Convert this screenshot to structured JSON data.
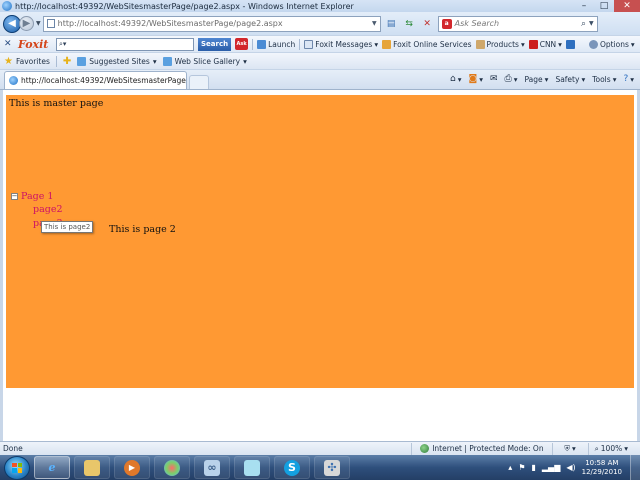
{
  "window": {
    "title": "http://localhost:49392/WebSitesmasterPage/page2.aspx - Windows Internet Explorer"
  },
  "address": {
    "url": "http://localhost:49392/WebSitesmasterPage/page2.aspx",
    "search_placeholder": "Ask Search"
  },
  "foxit": {
    "logo": "Foxit",
    "search_button": "Search",
    "ask_label": "Ask",
    "items": [
      "Launch",
      "Foxit Messages",
      "Foxit Online Services",
      "Products",
      "CNN",
      "Options"
    ]
  },
  "favorites": {
    "label": "Favorites",
    "items": [
      "Suggested Sites",
      "Web Slice Gallery"
    ]
  },
  "tab": {
    "label": "http://localhost:49392/WebSitesmasterPage/pag..."
  },
  "commands": {
    "page": "Page",
    "safety": "Safety",
    "tools": "Tools"
  },
  "content": {
    "master_text": "This is master page",
    "tree": {
      "root": "Page 1",
      "root_toggle": "−",
      "children": [
        "page2",
        "page3"
      ]
    },
    "page_text": "This is page 2",
    "tooltip": "This is page2"
  },
  "status": {
    "left": "Done",
    "zone": "Internet | Protected Mode: On",
    "zoom": "100%"
  },
  "taskbar": {
    "clock_time": "10:58 AM",
    "clock_date": "12/29/2010"
  },
  "colors": {
    "master_bg": "#ff9933",
    "tree_link": "#cc1166"
  }
}
